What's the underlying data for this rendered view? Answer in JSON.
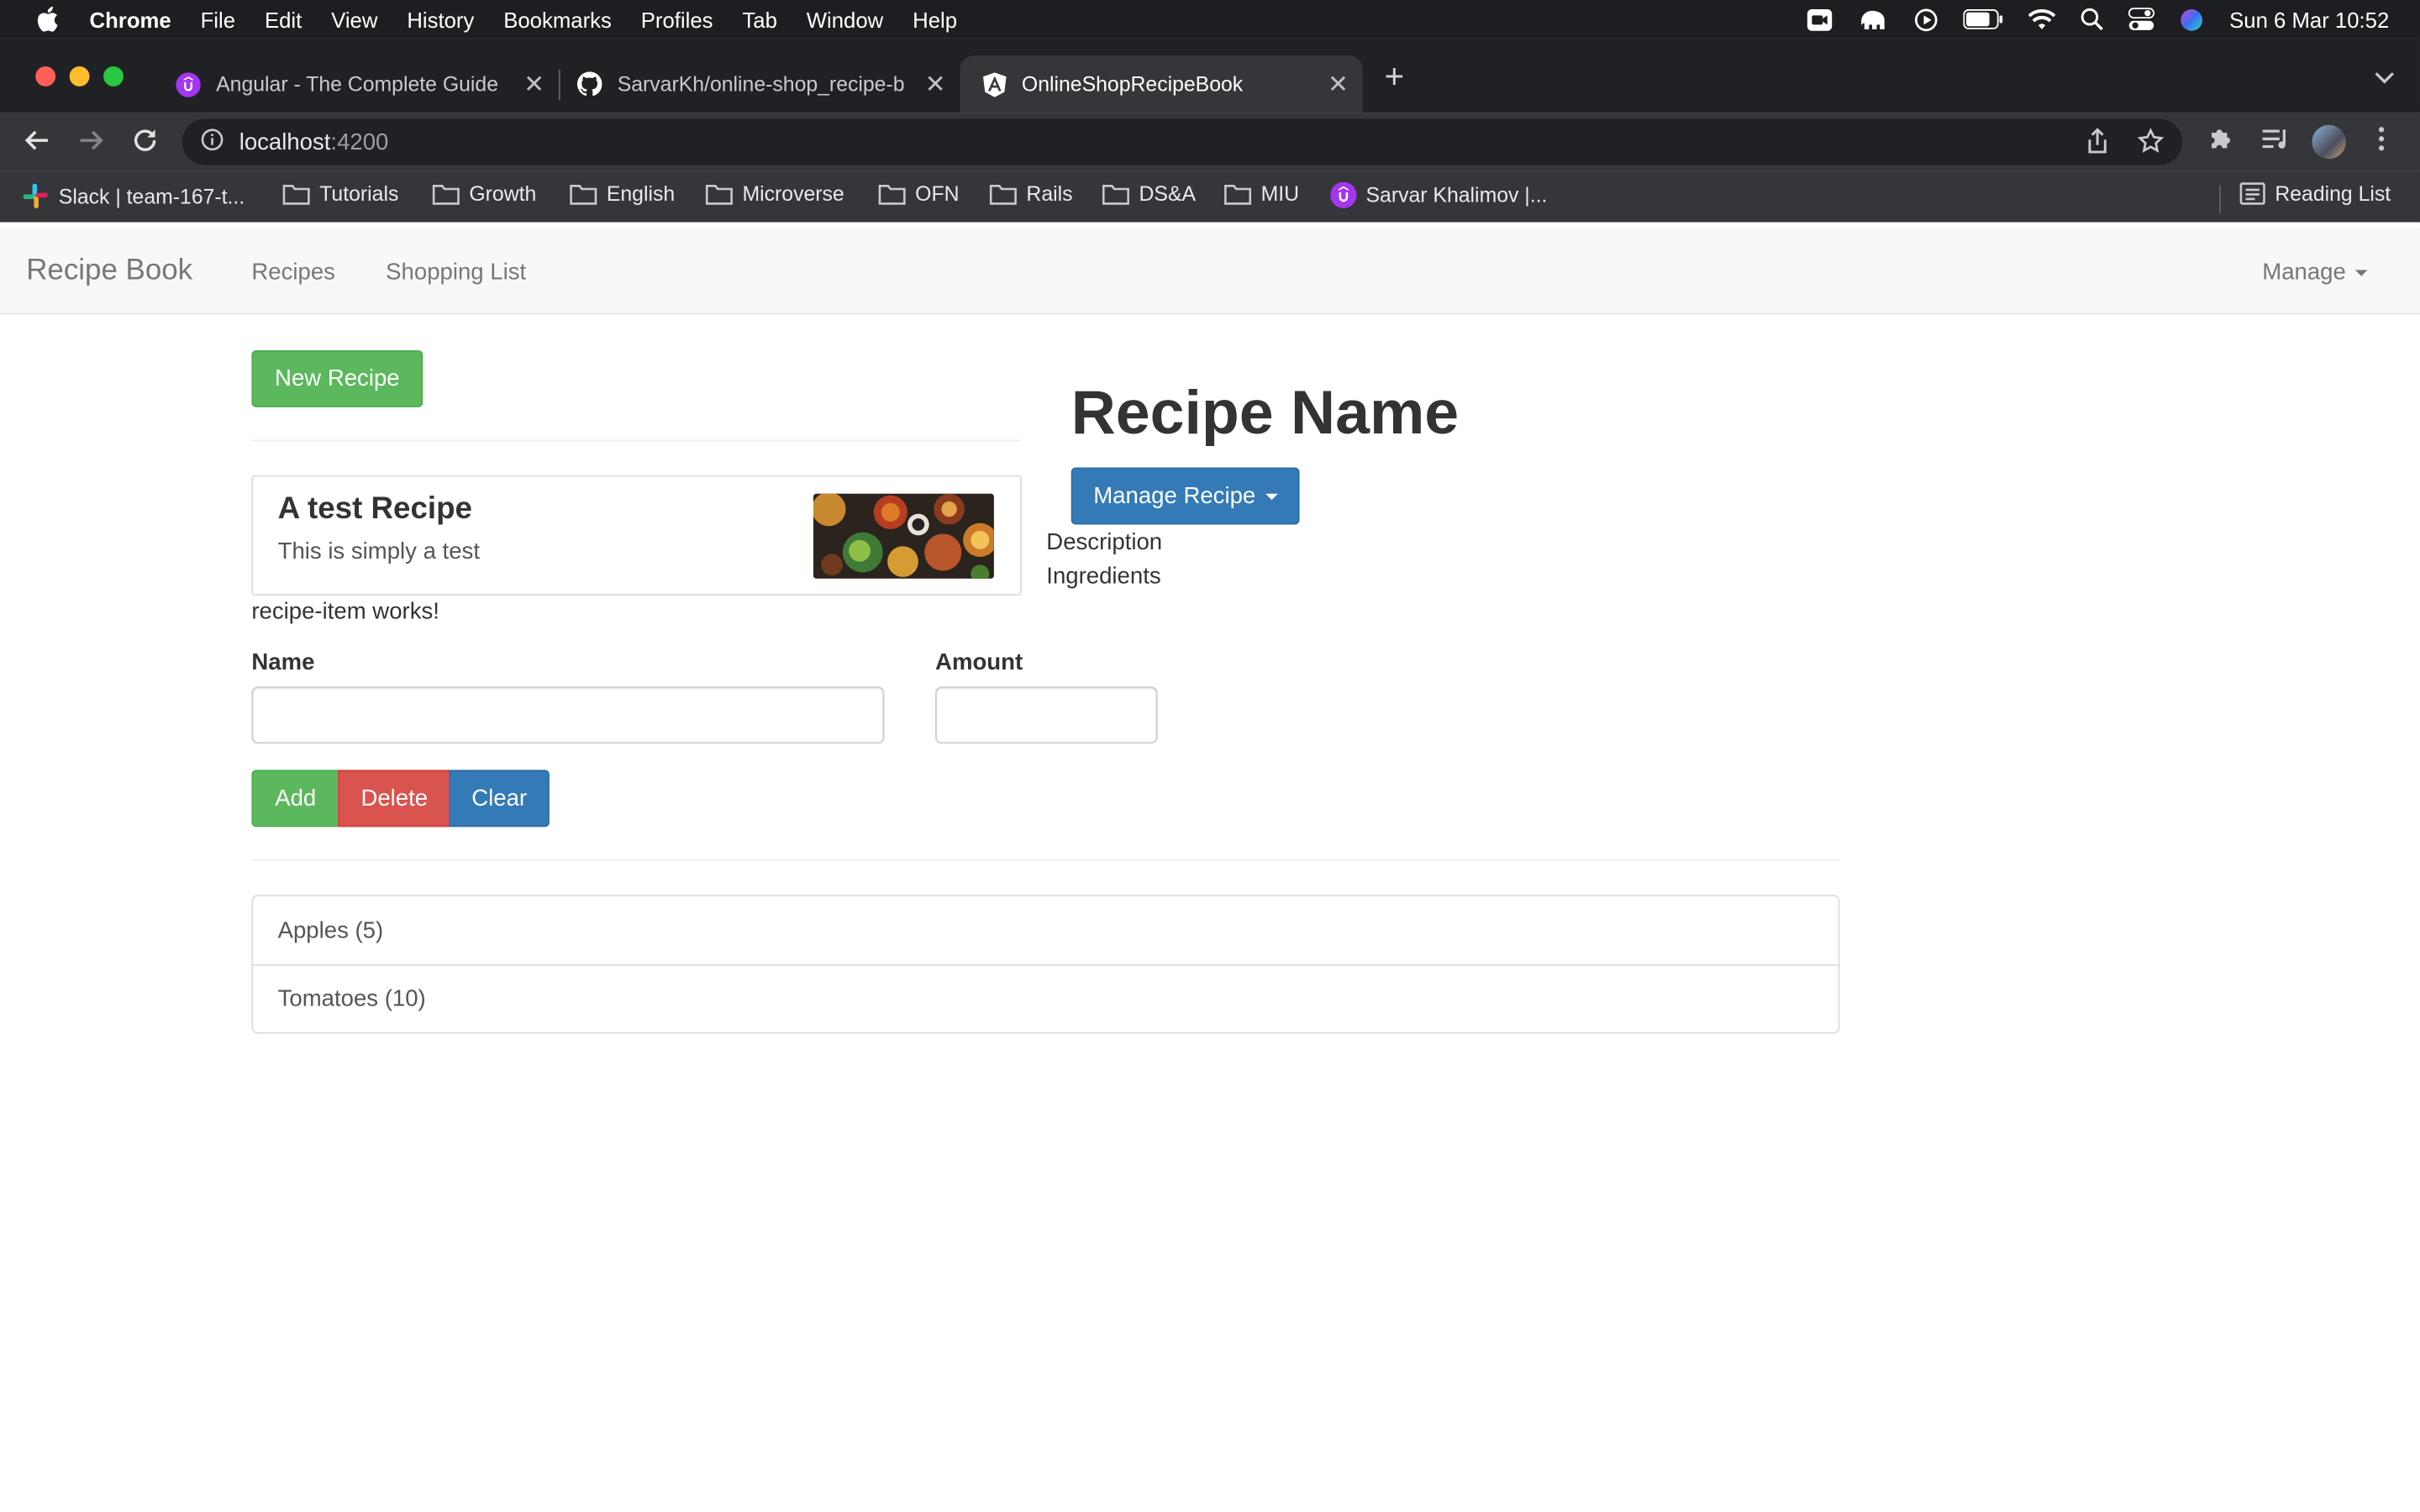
{
  "menubar": {
    "app_name": "Chrome",
    "items": [
      "File",
      "Edit",
      "View",
      "History",
      "Bookmarks",
      "Profiles",
      "Tab",
      "Window",
      "Help"
    ],
    "clock": "Sun 6 Mar  10:52"
  },
  "tabs": [
    {
      "title": "Angular - The Complete Guide",
      "icon": "udemy-icon",
      "active": false
    },
    {
      "title": "SarvarKh/online-shop_recipe-b",
      "icon": "github-icon",
      "active": false
    },
    {
      "title": "OnlineShopRecipeBook",
      "icon": "angular-icon",
      "active": true
    }
  ],
  "address": {
    "host": "localhost",
    "port": ":4200"
  },
  "bookmarks": [
    {
      "label": "Slack | team-167-t...",
      "icon": "slack-icon"
    },
    {
      "label": "Tutorials",
      "icon": "folder-icon"
    },
    {
      "label": "Growth",
      "icon": "folder-icon"
    },
    {
      "label": "English",
      "icon": "folder-icon"
    },
    {
      "label": "Microverse",
      "icon": "folder-icon"
    },
    {
      "label": "OFN",
      "icon": "folder-icon"
    },
    {
      "label": "Rails",
      "icon": "folder-icon"
    },
    {
      "label": "DS&A",
      "icon": "folder-icon"
    },
    {
      "label": "MIU",
      "icon": "folder-icon"
    },
    {
      "label": "Sarvar Khalimov |...",
      "icon": "udemy-icon"
    }
  ],
  "reading_list": "Reading List",
  "app": {
    "brand": "Recipe Book",
    "nav": [
      "Recipes",
      "Shopping List"
    ],
    "manage": "Manage"
  },
  "recipes": {
    "new_button": "New Recipe",
    "items": [
      {
        "name": "A test Recipe",
        "description": "This is simply a test"
      }
    ],
    "item_works_text": "recipe-item works!"
  },
  "detail": {
    "name": "Recipe Name",
    "manage_button": "Manage Recipe",
    "description": "Description",
    "ingredients": "Ingredients"
  },
  "shopping": {
    "name_label": "Name",
    "amount_label": "Amount",
    "name_value": "",
    "amount_value": "",
    "add": "Add",
    "delete": "Delete",
    "clear": "Clear",
    "items": [
      "Apples (5)",
      "Tomatoes (10)"
    ]
  },
  "colors": {
    "success": "#5cb85c",
    "danger": "#d9534f",
    "primary": "#337ab7"
  }
}
